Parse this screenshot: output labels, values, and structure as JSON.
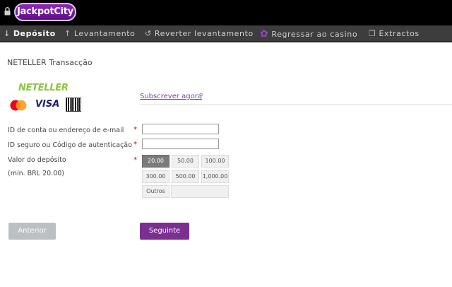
{
  "header": {
    "logo_text": "JackpotCity"
  },
  "nav": {
    "items": [
      {
        "label": "Depósito",
        "icon": "arrow-down-icon"
      },
      {
        "label": "Levantamento",
        "icon": "arrow-up-icon"
      },
      {
        "label": "Reverter levantamento",
        "icon": "undo-icon"
      },
      {
        "label": "Regressar ao casino",
        "icon": "casino-chip-icon"
      },
      {
        "label": "Extractos",
        "icon": "document-icon"
      }
    ]
  },
  "page": {
    "title": "NETELLER Transacção",
    "brand": "NETELLER",
    "card_visa": "VISA",
    "subscribe_link": "Subscrever agora",
    "help": "?"
  },
  "form": {
    "account_label": "ID de conta ou endereço de e-mail",
    "secure_label": "ID seguro ou Código de autenticação",
    "amount_label": "Valor do depósito",
    "min_label": "(mín. BRL 20.00)",
    "required_mark": "*",
    "amounts": [
      "20.00",
      "50.00",
      "100.00",
      "300.00",
      "500.00",
      "1,000.00"
    ],
    "selected_amount": "20.00",
    "other_label": "Outros"
  },
  "actions": {
    "previous": "Anterior",
    "next": "Seguinte"
  },
  "colors": {
    "brand_purple": "#7a2f91",
    "neteller_green": "#8cc63f",
    "required_red": "#cc0000"
  }
}
